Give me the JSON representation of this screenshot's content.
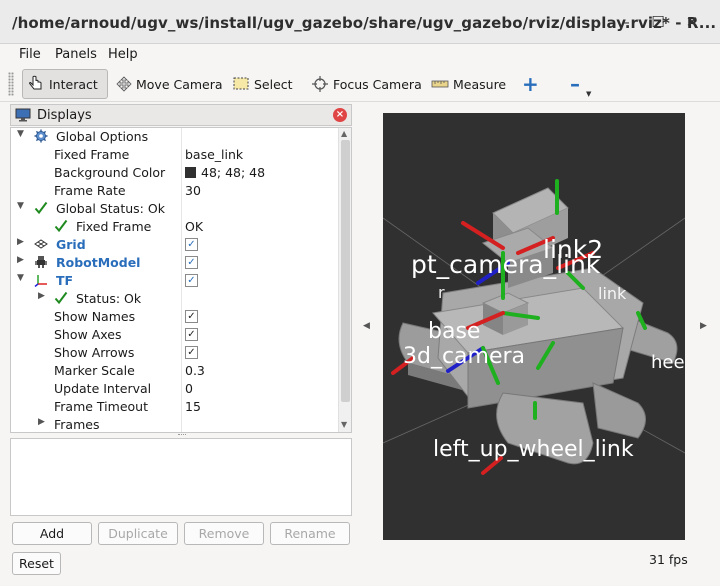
{
  "window": {
    "title": "/home/arnoud/ugv_ws/install/ugv_gazebo/share/ugv_gazebo/rviz/display.rviz* - R...",
    "minimize_glyph": "–",
    "maximize_glyph": "☐",
    "close_glyph": "✕"
  },
  "menu": {
    "file": "File",
    "panels": "Panels",
    "help": "Help"
  },
  "toolbar": {
    "interact": "Interact",
    "move_camera": "Move Camera",
    "select": "Select",
    "focus_camera": "Focus Camera",
    "measure": "Measure",
    "add_glyph": "+",
    "remove_glyph": "–"
  },
  "displays": {
    "title": "Displays",
    "close_glyph": "×",
    "rows": [
      {
        "label": "Global Options",
        "value": ""
      },
      {
        "label": "Fixed Frame",
        "value": "base_link"
      },
      {
        "label": "Background Color",
        "value": "48; 48; 48"
      },
      {
        "label": "Frame Rate",
        "value": "30"
      },
      {
        "label": "Global Status: Ok",
        "value": ""
      },
      {
        "label": "Fixed Frame",
        "value": "OK"
      },
      {
        "label": "Grid",
        "value": "✓"
      },
      {
        "label": "RobotModel",
        "value": "✓"
      },
      {
        "label": "TF",
        "value": "✓"
      },
      {
        "label": "Status: Ok",
        "value": ""
      },
      {
        "label": "Show Names",
        "value": "✓"
      },
      {
        "label": "Show Axes",
        "value": "✓"
      },
      {
        "label": "Show Arrows",
        "value": "✓"
      },
      {
        "label": "Marker Scale",
        "value": "0.3"
      },
      {
        "label": "Update Interval",
        "value": "0"
      },
      {
        "label": "Frame Timeout",
        "value": "15"
      },
      {
        "label": "Frames",
        "value": ""
      }
    ],
    "background_color_hex": "#303030",
    "link_color": "#2a6ebb"
  },
  "buttons": {
    "add": "Add",
    "duplicate": "Duplicate",
    "remove": "Remove",
    "rename": "Rename",
    "reset": "Reset"
  },
  "view": {
    "labels": {
      "pt_camera": "pt_camera_link",
      "link2": "link2",
      "base": "base",
      "camera3d": "3d_camera",
      "left_wheel": "left_up_wheel_link",
      "link_small": "link",
      "r_small": "r",
      "wheel_right": "hee"
    },
    "background_hex": "#303030"
  },
  "status": {
    "fps": "31 fps"
  }
}
